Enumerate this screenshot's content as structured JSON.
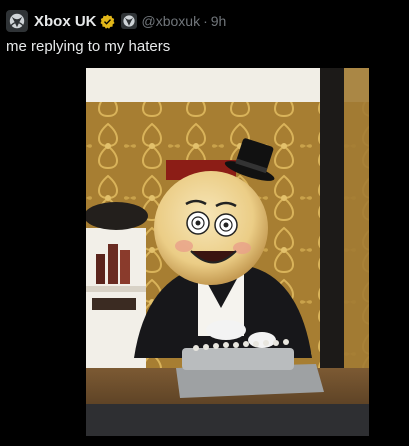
{
  "tweet": {
    "author_name": "Xbox UK",
    "handle": "@xboxuk",
    "separator": "·",
    "time": "9h",
    "text": "me replying to my haters",
    "icons": {
      "avatar": "xbox-logo",
      "verified": "gold-verified-badge",
      "affiliate": "xbox-affiliate-badge"
    },
    "colors": {
      "background": "#000000",
      "text": "#e7e9ea",
      "muted": "#71767b",
      "verified_gold": "#e2b719"
    }
  }
}
